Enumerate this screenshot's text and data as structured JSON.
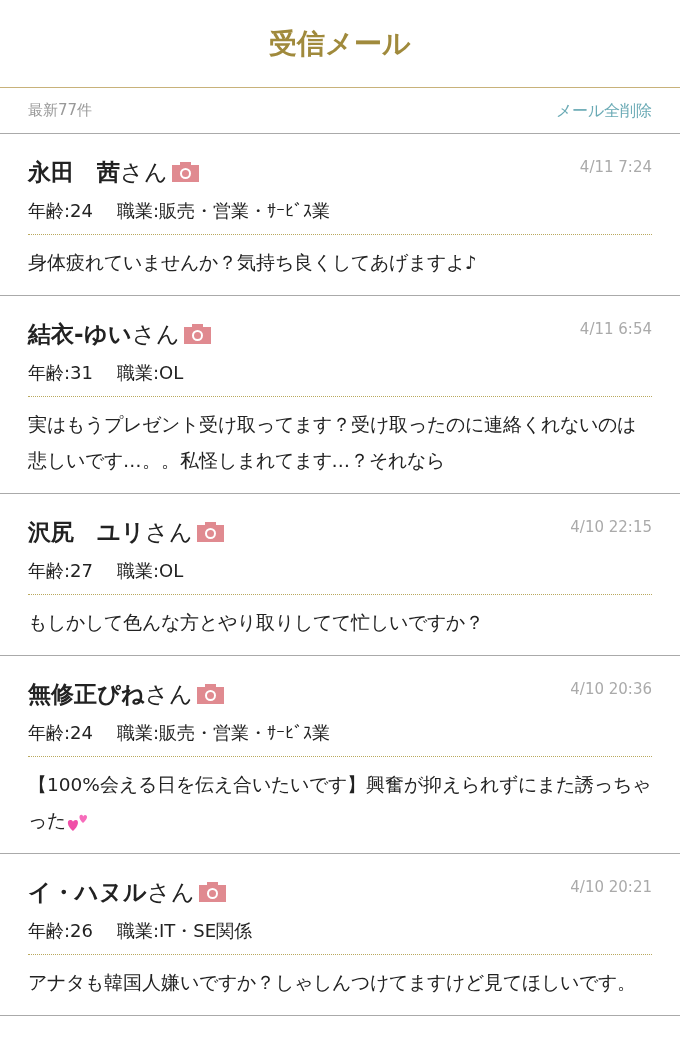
{
  "header": {
    "title": "受信メール"
  },
  "toolbar": {
    "count": "最新77件",
    "delete_all": "メール全削除"
  },
  "messages": [
    {
      "name": "**永田　茜**さん",
      "time": "4/11 7:24",
      "age": "年齢:24",
      "job": "職業:販売・営業・ｻｰﾋﾞｽ業",
      "text": "身体疲れていませんか？気持ち良くしてあげますよ♪"
    },
    {
      "name": "**結衣-ゆい**さん",
      "time": "4/11 6:54",
      "age": "年齢:31",
      "job": "職業:OL",
      "text": "実はもうプレゼント受け取ってます？受け取ったのに連絡くれないのは悲しいです…。。私怪しまれてます…？それなら"
    },
    {
      "name": "**沢尻　ユリ**さん",
      "time": "4/10 22:15",
      "age": "年齢:27",
      "job": "職業:OL",
      "text": "もしかして色んな方とやり取りしてて忙しいですか？"
    },
    {
      "name": "**無修正ぴね**さん",
      "time": "4/10 20:36",
      "age": "年齢:24",
      "job": "職業:販売・営業・ｻｰﾋﾞｽ業",
      "text": "【100%会える日を伝え合いたいです】興奮が抑えられずにまた誘っちゃった",
      "kind": "hearts"
    },
    {
      "name": "**イ・ハヌル**さん",
      "time": "4/10 20:21",
      "age": "年齢:26",
      "job": "職業:IT・SE関係",
      "text": "アナタも韓国人嫌いですか？しゃしんつけてますけど見てほしいです。"
    }
  ]
}
